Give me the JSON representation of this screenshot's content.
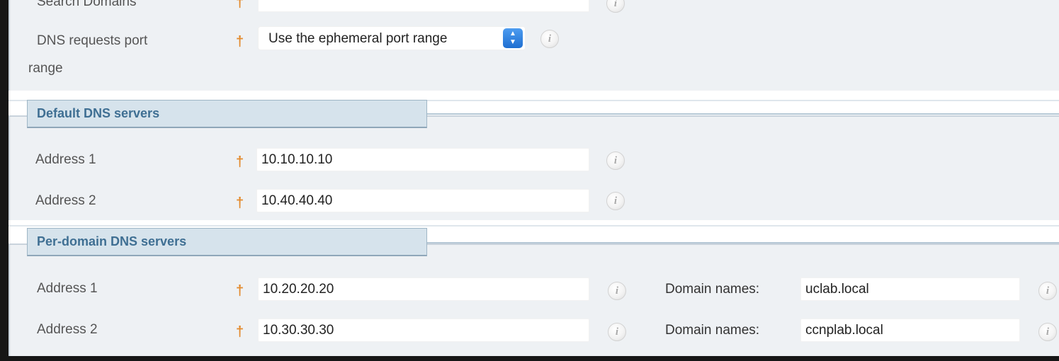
{
  "general": {
    "search_domains_label": "Search Domains",
    "search_domains_value": "",
    "port_range_label_line1": "DNS requests port",
    "port_range_label_line2": "range",
    "port_range_value": "Use the ephemeral port range"
  },
  "default_dns": {
    "title": "Default DNS servers",
    "address1_label": "Address 1",
    "address1_value": "10.10.10.10",
    "address2_label": "Address 2",
    "address2_value": "10.40.40.40"
  },
  "per_domain_dns": {
    "title": "Per-domain DNS servers",
    "rows": [
      {
        "address_label": "Address 1",
        "address_value": "10.20.20.20",
        "domain_label": "Domain names:",
        "domain_value": "uclab.local"
      },
      {
        "address_label": "Address 2",
        "address_value": "10.30.30.30",
        "domain_label": "Domain names:",
        "domain_value": "ccnplab.local"
      }
    ]
  },
  "icons": {
    "required": "required-marker-icon",
    "info": "info-icon",
    "select_arrow": "select-arrows-icon"
  },
  "colors": {
    "section_title": "#3f6f93",
    "required_marker": "#e38a2c",
    "select_arrow": "#2b7de0"
  }
}
